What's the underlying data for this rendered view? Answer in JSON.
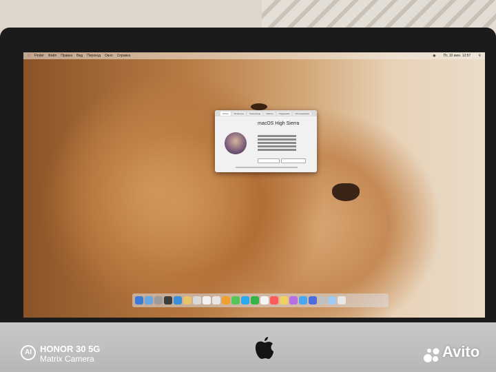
{
  "menubar": {
    "items": [
      "Finder",
      "Файл",
      "Правка",
      "Вид",
      "Переход",
      "Окно",
      "Справка"
    ],
    "clock": "Пт, 10 июн. 12:57"
  },
  "about_window": {
    "tabs": [
      "Обзор",
      "Мониторы",
      "Хранилище",
      "Память",
      "Поддержка",
      "Обслуживание"
    ],
    "os_name": "macOS High Sierra"
  },
  "dock": {
    "colors": [
      "#3b7bd6",
      "#6aa7e0",
      "#9c9c9c",
      "#3d3d3d",
      "#3a8fd9",
      "#e8c46a",
      "#d8d8d8",
      "#f2f2f2",
      "#e6e6e6",
      "#f0a030",
      "#53c65a",
      "#2aa8f0",
      "#38b34a",
      "#f4f4f4",
      "#ff5a5a",
      "#f0d060",
      "#b86ee0",
      "#49a7f0",
      "#4a6cdc",
      "#c0c0c0",
      "#9ecbf2",
      "#e8e8e8"
    ]
  },
  "watermarks": {
    "phone_badge": "AI",
    "phone_brand": "HONOR 30 5G",
    "phone_camera": "Matrix Camera",
    "site": "Avito"
  }
}
